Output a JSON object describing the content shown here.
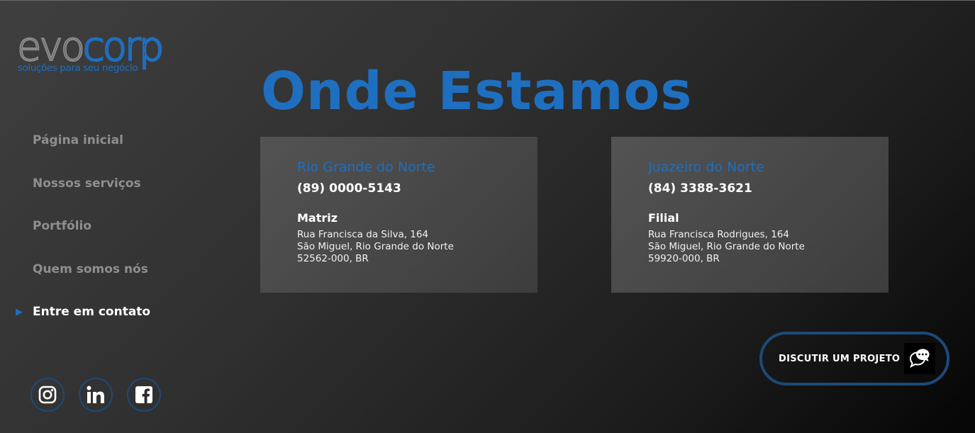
{
  "logo": {
    "evo": "evo",
    "corp": "corp",
    "tagline": "soluções para seu negócio"
  },
  "nav": {
    "items": [
      {
        "label": "Página inicial"
      },
      {
        "label": "Nossos serviços"
      },
      {
        "label": "Portfólio"
      },
      {
        "label": "Quem somos nós"
      },
      {
        "label": "Entre em contato",
        "active": true
      }
    ],
    "active_marker": "▶"
  },
  "title": "Onde Estamos",
  "locations": [
    {
      "city": "Rio Grande do Norte",
      "phone": "(89) 0000-5143",
      "type": "Matriz",
      "address": [
        "Rua Francisca da Silva, 164",
        "São Miguel, Rio Grande do Norte",
        "52562-000, BR"
      ]
    },
    {
      "city": "Juazeiro do Norte",
      "phone": "(84) 3388-3621",
      "type": "Filial",
      "address": [
        "Rua Francisca Rodrigues, 164",
        "São Miguel, Rio Grande do Norte",
        "59920-000, BR"
      ]
    }
  ],
  "cta": {
    "label": "DISCUTIR UM PROJETO",
    "icon": "chat-bubbles-icon"
  },
  "social": [
    {
      "icon": "instagram-icon"
    },
    {
      "icon": "linkedin-icon"
    },
    {
      "icon": "facebook-icon"
    }
  ],
  "colors": {
    "accent": "#1f6fc0",
    "accent_dark": "#1d4a78",
    "nav_inactive": "#8f8f8f",
    "card_bg": "#4a4a4a"
  }
}
